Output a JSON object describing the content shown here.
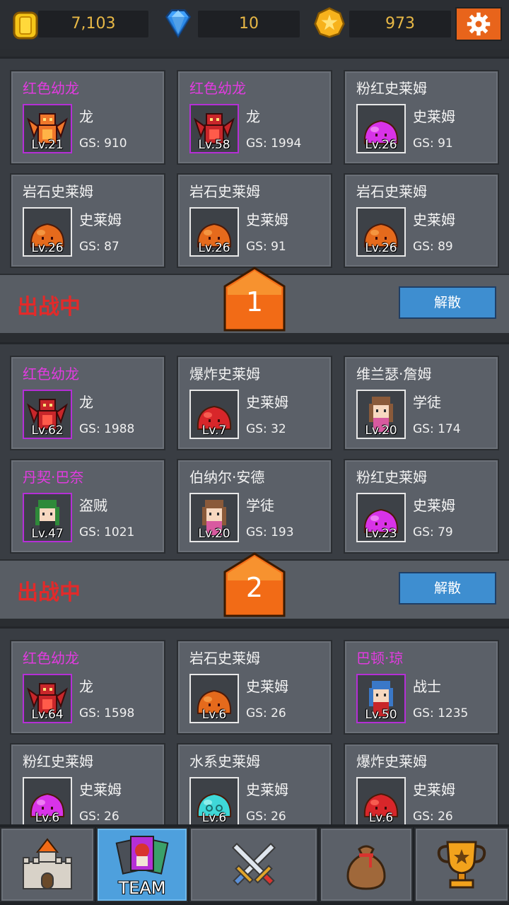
{
  "resources": {
    "gold": "7,103",
    "gems": "10",
    "star_coins": "973"
  },
  "teams": [
    {
      "badge": "1",
      "status": "出战中",
      "disband": "解散",
      "members": [
        {
          "name": "红色幼龙",
          "rare": true,
          "type": "龙",
          "level": "Lv.21",
          "gs": "GS: 910",
          "sprite": "orange-dragon"
        },
        {
          "name": "红色幼龙",
          "rare": true,
          "type": "龙",
          "level": "Lv.58",
          "gs": "GS: 1994",
          "sprite": "red-dragon"
        },
        {
          "name": "粉红史莱姆",
          "rare": false,
          "type": "史莱姆",
          "level": "Lv.26",
          "gs": "GS: 91",
          "sprite": "pink-slime"
        },
        {
          "name": "岩石史莱姆",
          "rare": false,
          "type": "史莱姆",
          "level": "Lv.26",
          "gs": "GS: 87",
          "sprite": "orange-slime"
        },
        {
          "name": "岩石史莱姆",
          "rare": false,
          "type": "史莱姆",
          "level": "Lv.26",
          "gs": "GS: 91",
          "sprite": "orange-slime"
        },
        {
          "name": "岩石史莱姆",
          "rare": false,
          "type": "史莱姆",
          "level": "Lv.26",
          "gs": "GS: 89",
          "sprite": "orange-slime"
        }
      ]
    },
    {
      "badge": "2",
      "status": "出战中",
      "disband": "解散",
      "members": [
        {
          "name": "红色幼龙",
          "rare": true,
          "type": "龙",
          "level": "Lv.62",
          "gs": "GS: 1988",
          "sprite": "red-dragon"
        },
        {
          "name": "爆炸史莱姆",
          "rare": false,
          "type": "史莱姆",
          "level": "Lv.7",
          "gs": "GS: 32",
          "sprite": "red-slime"
        },
        {
          "name": "维兰瑟·詹姆",
          "rare": false,
          "type": "学徒",
          "level": "Lv.20",
          "gs": "GS: 174",
          "sprite": "apprentice"
        },
        {
          "name": "丹契·巴奈",
          "rare": true,
          "type": "盗贼",
          "level": "Lv.47",
          "gs": "GS: 1021",
          "sprite": "thief"
        },
        {
          "name": "伯纳尔·安德",
          "rare": false,
          "type": "学徒",
          "level": "Lv.20",
          "gs": "GS: 193",
          "sprite": "apprentice"
        },
        {
          "name": "粉红史莱姆",
          "rare": false,
          "type": "史莱姆",
          "level": "Lv.23",
          "gs": "GS: 79",
          "sprite": "pink-slime"
        }
      ]
    },
    {
      "members": [
        {
          "name": "红色幼龙",
          "rare": true,
          "type": "龙",
          "level": "Lv.64",
          "gs": "GS: 1598",
          "sprite": "red-dragon"
        },
        {
          "name": "岩石史莱姆",
          "rare": false,
          "type": "史莱姆",
          "level": "Lv.6",
          "gs": "GS: 26",
          "sprite": "orange-slime"
        },
        {
          "name": "巴顿·琼",
          "rare": true,
          "type": "战士",
          "level": "Lv.50",
          "gs": "GS: 1235",
          "sprite": "warrior"
        },
        {
          "name": "粉红史莱姆",
          "rare": false,
          "type": "史莱姆",
          "level": "Lv.6",
          "gs": "GS: 26",
          "sprite": "pink-slime"
        },
        {
          "name": "水系史莱姆",
          "rare": false,
          "type": "史莱姆",
          "level": "Lv.6",
          "gs": "GS: 26",
          "sprite": "cyan-slime"
        },
        {
          "name": "爆炸史莱姆",
          "rare": false,
          "type": "史莱姆",
          "level": "Lv.6",
          "gs": "GS: 26",
          "sprite": "red-slime"
        }
      ]
    }
  ],
  "nav": [
    {
      "icon": "castle-icon",
      "label": ""
    },
    {
      "icon": "team-cards-icon",
      "label": "TEAM",
      "active": true
    },
    {
      "icon": "crossed-swords-icon",
      "label": ""
    },
    {
      "icon": "loot-bag-icon",
      "label": ""
    },
    {
      "icon": "trophy-icon",
      "label": ""
    }
  ],
  "colors": {
    "accent_orange": "#e8641b",
    "rare_name": "#e23be0",
    "status_red": "#e22a2a",
    "disband_blue": "#3e8ed0",
    "nav_active": "#4ea0dd"
  }
}
